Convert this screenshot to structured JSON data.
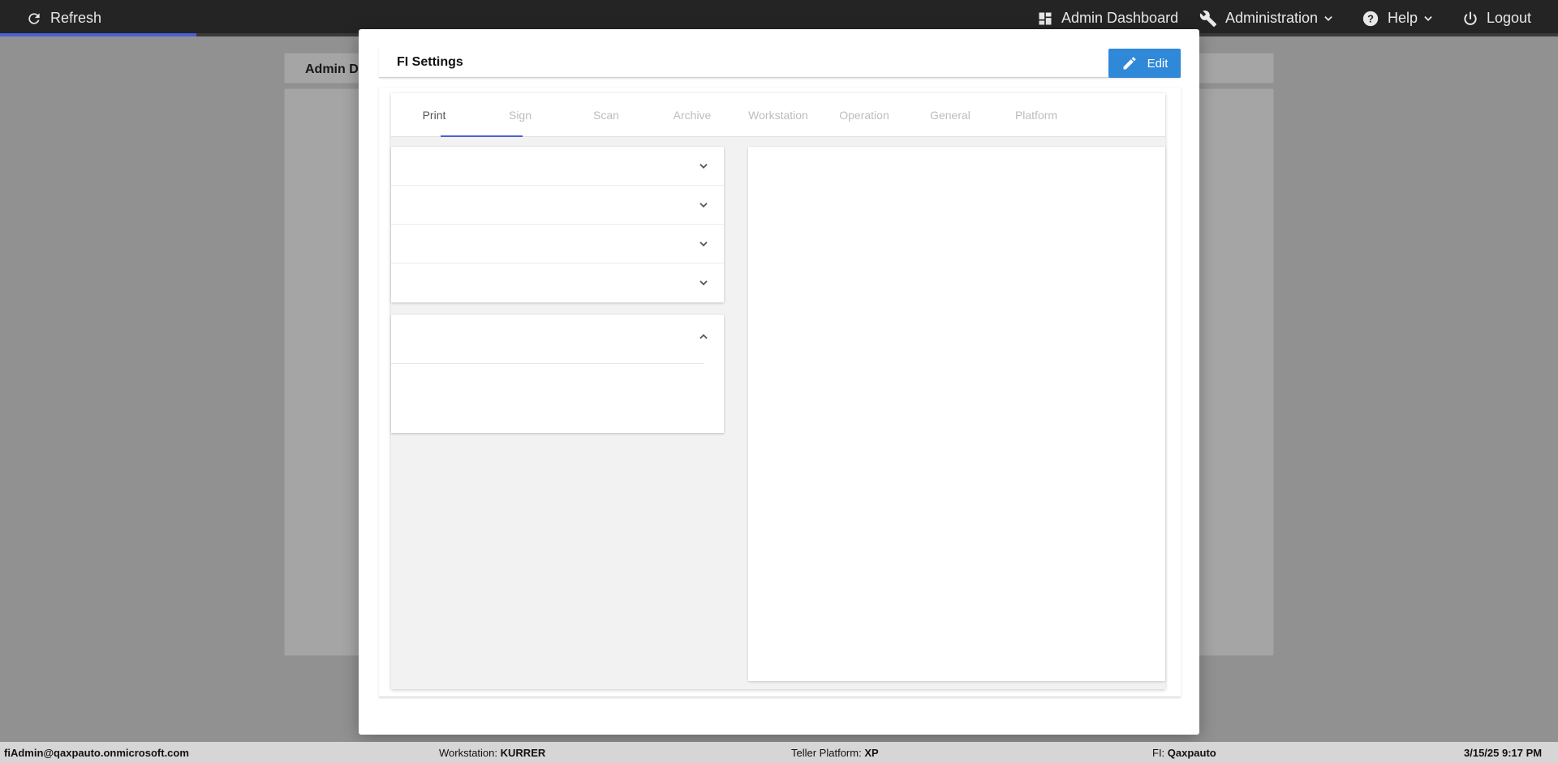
{
  "topbar": {
    "refresh_label": "Refresh",
    "admin_dashboard_label": "Admin Dashboard",
    "administration_label": "Administration",
    "help_label": "Help",
    "logout_label": "Logout"
  },
  "background": {
    "header_title": "Admin D"
  },
  "modal": {
    "title": "FI Settings",
    "edit_label": "Edit",
    "tabs": [
      {
        "label": "Print",
        "active": true
      },
      {
        "label": "Sign"
      },
      {
        "label": "Scan"
      },
      {
        "label": "Archive"
      },
      {
        "label": "Workstation"
      },
      {
        "label": "Operation"
      },
      {
        "label": "General"
      },
      {
        "label": "Platform"
      }
    ]
  },
  "statusbar": {
    "user": "fiAdmin@qaxpauto.onmicrosoft.com",
    "workstation_label": "Workstation:",
    "workstation_value": "KURRER",
    "platform_label": "Teller Platform:",
    "platform_value": "XP",
    "fi_label": "FI:",
    "fi_value": "Qaxpauto",
    "datetime": "3/15/25 9:17 PM"
  },
  "colors": {
    "topbar_bg": "#242424",
    "accent": "#4a5fd6",
    "edit_button": "#2f88d8"
  }
}
